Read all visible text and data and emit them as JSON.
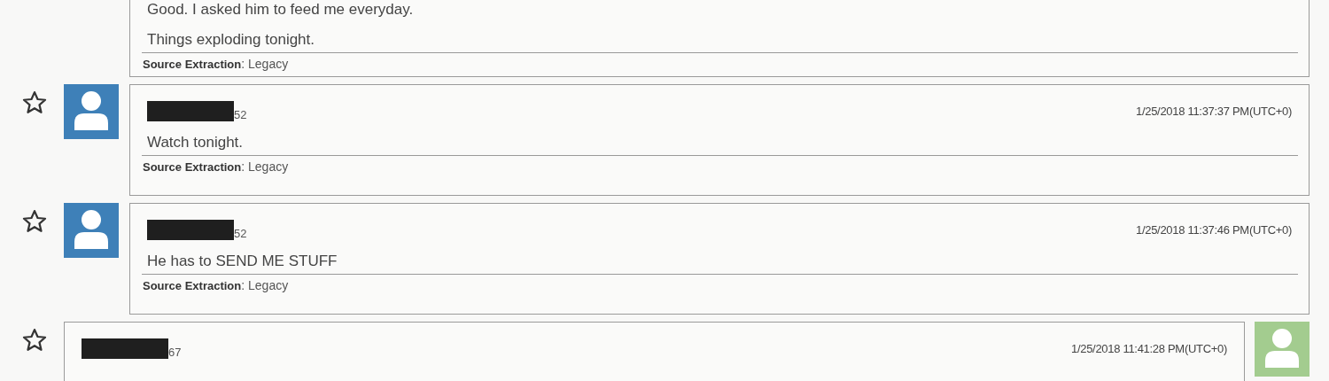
{
  "messages": [
    {
      "kind": "incoming",
      "paragraphs": [
        "Good. I asked him to feed me everyday.",
        "Things exploding tonight."
      ],
      "source": "**Source Extraction**: Legacy"
    },
    {
      "kind": "incoming",
      "starred": false,
      "sender_suffix": "52",
      "timestamp": "1/25/2018 11:37:37 PM(UTC+0)",
      "paragraphs": [
        "Watch tonight."
      ],
      "source": "**Source Extraction**: Legacy"
    },
    {
      "kind": "incoming",
      "starred": false,
      "sender_suffix": "52",
      "timestamp": "1/25/2018 11:37:46 PM(UTC+0)",
      "paragraphs": [
        "He has to SEND ME STUFF"
      ],
      "source": "**Source Extraction**: Legacy"
    },
    {
      "kind": "outgoing",
      "starred": false,
      "sender_suffix": "67",
      "timestamp": "1/25/2018 11:41:28 PM(UTC+0)"
    }
  ]
}
